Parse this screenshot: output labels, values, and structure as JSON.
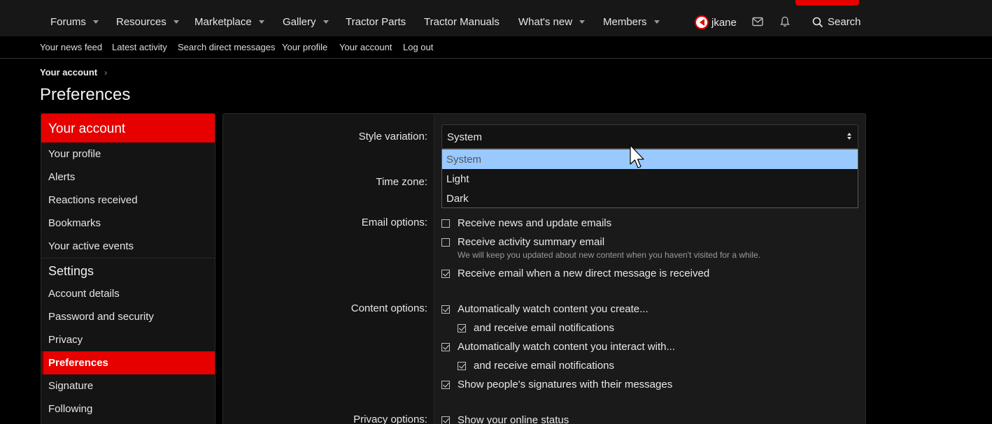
{
  "nav": {
    "items": [
      {
        "label": "Forums",
        "caret": true
      },
      {
        "label": "Resources",
        "caret": true
      },
      {
        "label": "Marketplace",
        "caret": true
      },
      {
        "label": "Gallery",
        "caret": true
      },
      {
        "label": "Tractor Parts",
        "caret": false
      },
      {
        "label": "Tractor Manuals",
        "caret": false
      },
      {
        "label": "What's new",
        "caret": true
      },
      {
        "label": "Members",
        "caret": true
      }
    ],
    "username": "jkane",
    "search_label": "Search",
    "accent": "#e60000"
  },
  "subnav": [
    "Your news feed",
    "Latest activity",
    "Search direct messages",
    "Your profile",
    "Your account",
    "Log out"
  ],
  "breadcrumb": "Your account",
  "page_title": "Preferences",
  "sidebar": {
    "header": "Your account",
    "items": [
      "Your profile",
      "Alerts",
      "Reactions received",
      "Bookmarks",
      "Your active events"
    ],
    "settings_header": "Settings",
    "settings_items": [
      "Account details",
      "Password and security",
      "Privacy",
      "Preferences",
      "Signature",
      "Following"
    ],
    "active": "Preferences"
  },
  "form": {
    "style_label": "Style variation:",
    "style_value": "System",
    "style_options": [
      "System",
      "Light",
      "Dark"
    ],
    "timezone_label": "Time zone:",
    "email_label": "Email options:",
    "email_options": [
      {
        "label": "Receive news and update emails",
        "checked": false
      },
      {
        "label": "Receive activity summary email",
        "checked": false
      },
      {
        "label": "Receive email when a new direct message is received",
        "checked": true
      }
    ],
    "email_hint": "We will keep you updated about new content when you haven't visited for a while.",
    "content_label": "Content options:",
    "content_options": [
      {
        "label": "Automatically watch content you create...",
        "checked": true
      },
      {
        "label": "and receive email notifications",
        "checked": true
      },
      {
        "label": "Automatically watch content you interact with...",
        "checked": true
      },
      {
        "label": "and receive email notifications",
        "checked": true
      },
      {
        "label": "Show people's signatures with their messages",
        "checked": true
      }
    ],
    "privacy_label": "Privacy options:",
    "privacy_options": [
      {
        "label": "Show your online status",
        "checked": true
      }
    ]
  }
}
